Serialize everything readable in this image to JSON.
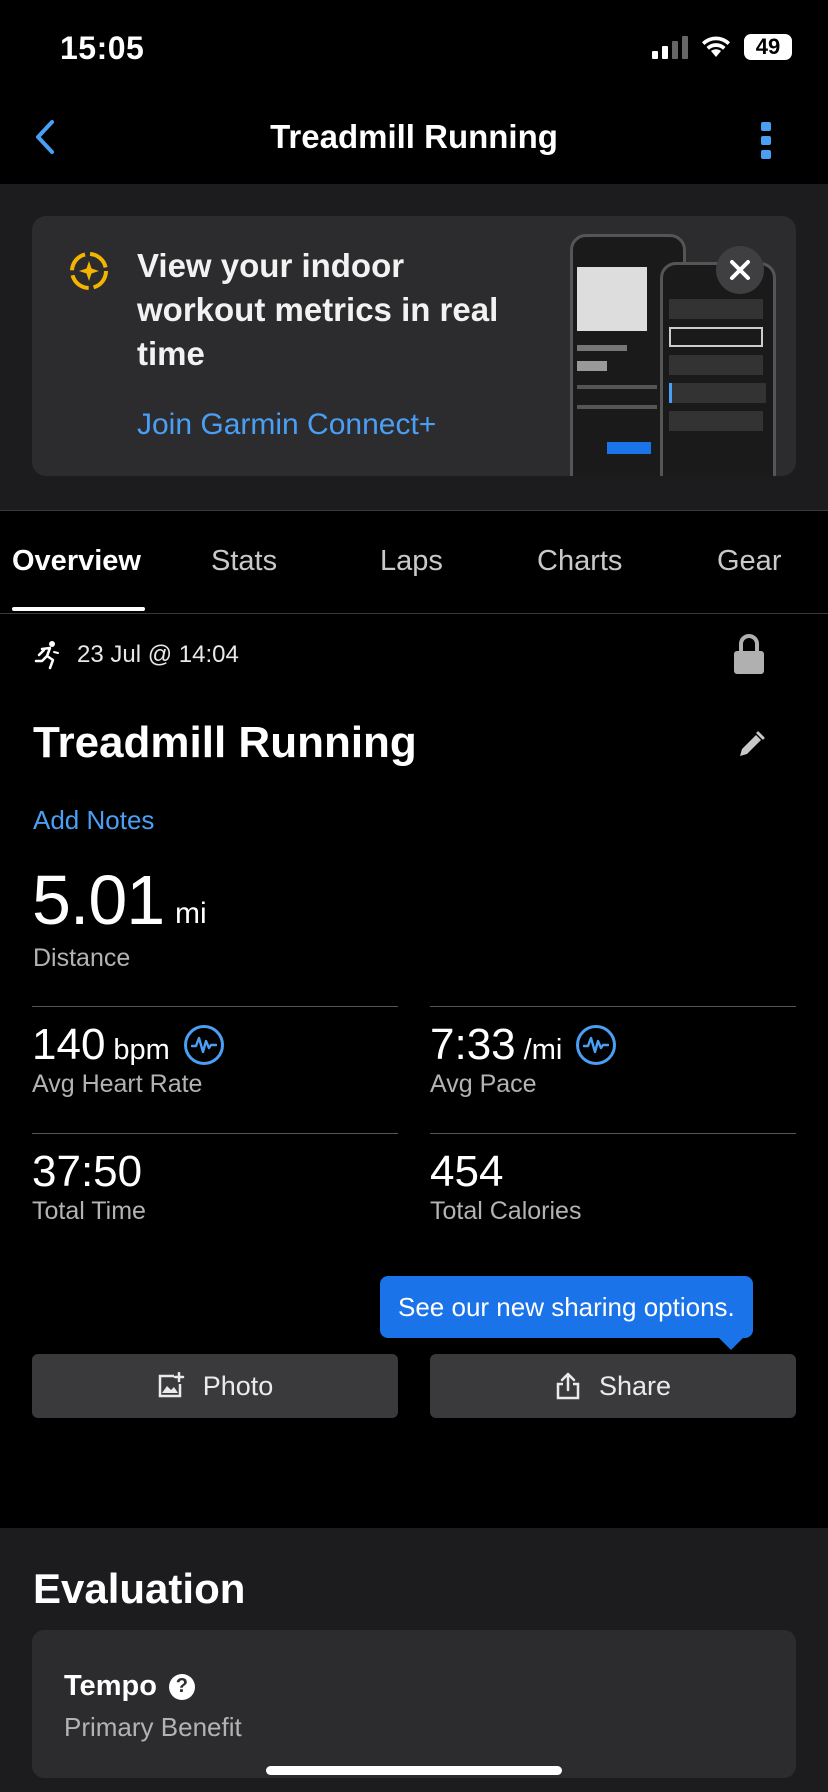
{
  "status_bar": {
    "time": "15:05",
    "battery": "49"
  },
  "nav": {
    "title": "Treadmill Running"
  },
  "promo": {
    "title": "View your indoor workout metrics in real time",
    "link": "Join Garmin Connect+"
  },
  "tabs": [
    {
      "label": "Overview",
      "active": true
    },
    {
      "label": "Stats"
    },
    {
      "label": "Laps"
    },
    {
      "label": "Charts"
    },
    {
      "label": "Gear"
    }
  ],
  "overview": {
    "date": "23 Jul @ 14:04",
    "activity_title": "Treadmill Running",
    "add_notes": "Add Notes",
    "distance": {
      "value": "5.01",
      "unit": "mi",
      "label": "Distance"
    },
    "stats": [
      {
        "value": "140",
        "unit": "bpm",
        "label": "Avg Heart Rate"
      },
      {
        "value": "7:33",
        "unit": "/mi",
        "label": "Avg Pace"
      },
      {
        "value": "37:50",
        "unit": "",
        "label": "Total Time"
      },
      {
        "value": "454",
        "unit": "",
        "label": "Total Calories"
      }
    ]
  },
  "tooltip": "See our new sharing options.",
  "buttons": {
    "photo": "Photo",
    "share": "Share"
  },
  "evaluation": {
    "title": "Evaluation",
    "name": "Tempo",
    "subtitle": "Primary Benefit"
  },
  "colors": {
    "accent": "#4a9ff5",
    "tooltip": "#1a73e8",
    "promo_icon": "#f5b400"
  }
}
